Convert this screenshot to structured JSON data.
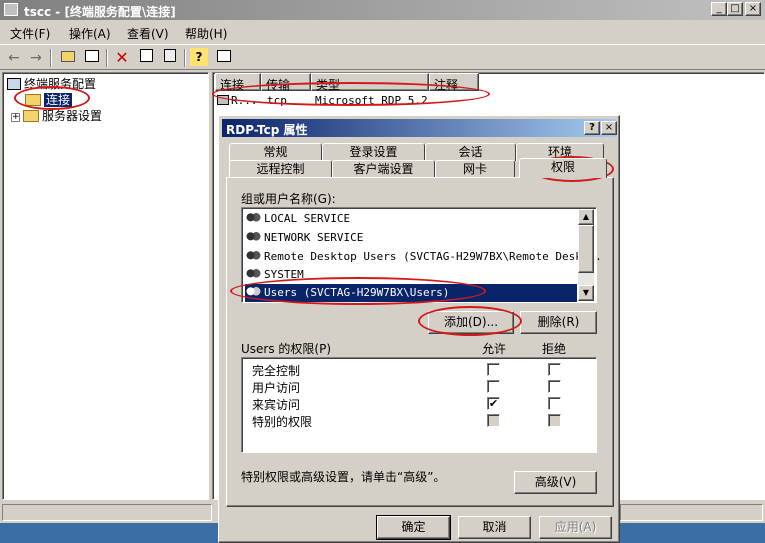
{
  "window": {
    "title": "tscc - [终端服务配置\\连接]",
    "controls": {
      "minimize": "_",
      "maximize": "□",
      "close": "×"
    }
  },
  "menu": {
    "items": [
      {
        "label": "文件(F)"
      },
      {
        "label": "操作(A)"
      },
      {
        "label": "查看(V)"
      },
      {
        "label": "帮助(H)"
      }
    ]
  },
  "toolbar": {
    "icons": [
      "back-icon",
      "forward-icon",
      "up-folder-icon",
      "show-tree-icon",
      "delete-icon",
      "properties-icon",
      "export-icon",
      "help-icon",
      "console-icon"
    ]
  },
  "tree": {
    "root": "终端服务配置",
    "connections": "连接",
    "server_settings": "服务器设置"
  },
  "list": {
    "columns": [
      "连接",
      "传输",
      "类型",
      "注释"
    ],
    "rows": [
      {
        "name": "R...",
        "transport": "tcp",
        "type": "Microsoft RDP 5.2",
        "comment": ""
      }
    ]
  },
  "dialog": {
    "title": "RDP-Tcp 属性",
    "help": "?",
    "close": "×",
    "tabs_row1": [
      "常规",
      "登录设置",
      "会话",
      "环境"
    ],
    "tabs_row2": [
      "远程控制",
      "客户端设置",
      "网卡",
      "权限"
    ],
    "group_label": "组或用户名称(G):",
    "users": [
      {
        "name": "LOCAL SERVICE"
      },
      {
        "name": "NETWORK SERVICE"
      },
      {
        "name": "Remote Desktop Users (SVCTAG-H29W7BX\\Remote Desk..."
      },
      {
        "name": "SYSTEM"
      },
      {
        "name": "Users (SVCTAG-H29W7BX\\Users)"
      }
    ],
    "selected_user_index": 4,
    "add_button": "添加(D)...",
    "remove_button": "删除(R)",
    "permissions_label": "Users 的权限(P)",
    "allow_label": "允许",
    "deny_label": "拒绝",
    "permissions": [
      {
        "name": "完全控制",
        "allow": false,
        "deny": false,
        "disabled": false
      },
      {
        "name": "用户访问",
        "allow": false,
        "deny": false,
        "disabled": false
      },
      {
        "name": "来宾访问",
        "allow": true,
        "deny": false,
        "disabled": false
      },
      {
        "name": "特别的权限",
        "allow": false,
        "deny": false,
        "disabled": true
      }
    ],
    "advanced_hint": "特别权限或高级设置，请单击“高级”。",
    "advanced_button": "高级(V)",
    "ok_button": "确定",
    "cancel_button": "取消",
    "apply_button": "应用(A)"
  },
  "colors": {
    "title_active": "#0a246a",
    "title_inactive": "#808080",
    "face": "#d4d0c8",
    "annotation": "#d21a1a"
  }
}
